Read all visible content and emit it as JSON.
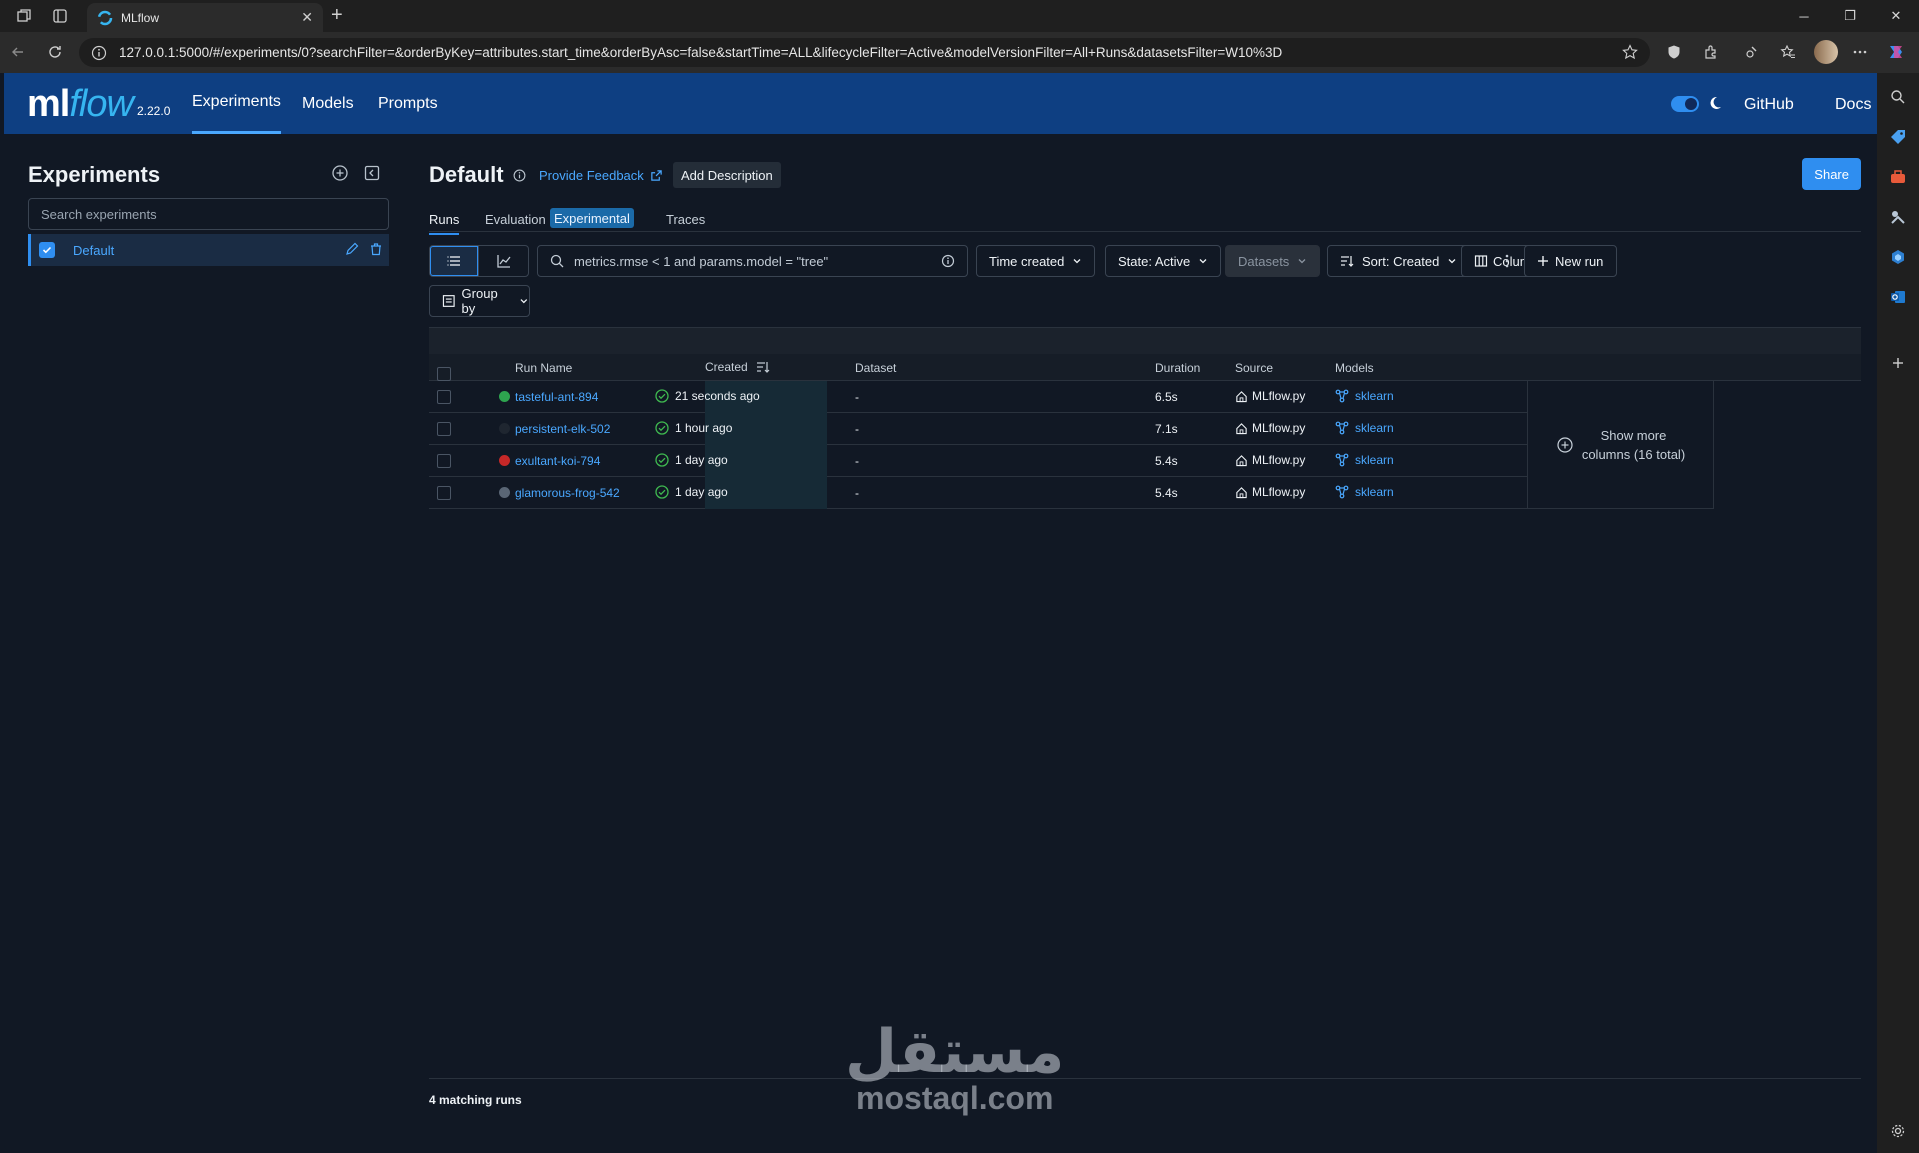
{
  "browser": {
    "tab_title": "MLflow",
    "url": "127.0.0.1:5000/#/experiments/0?searchFilter=&orderByKey=attributes.start_time&orderByAsc=false&startTime=ALL&lifecycleFilter=Active&modelVersionFilter=All+Runs&datasetsFilter=W10%3D"
  },
  "header": {
    "logo_ml": "ml",
    "logo_flow": "flow",
    "version": "2.22.0",
    "nav": [
      "Experiments",
      "Models",
      "Prompts"
    ],
    "links": [
      "GitHub",
      "Docs"
    ]
  },
  "sidebar": {
    "title": "Experiments",
    "search_placeholder": "Search experiments",
    "items": [
      {
        "label": "Default"
      }
    ]
  },
  "main": {
    "title": "Default",
    "feedback": "Provide Feedback",
    "add_description": "Add Description",
    "share": "Share",
    "tabs": {
      "runs": "Runs",
      "evaluation": "Evaluation",
      "experimental": "Experimental",
      "traces": "Traces"
    },
    "filter_text": "metrics.rmse < 1 and params.model = \"tree\"",
    "time_created": "Time created",
    "state": "State: Active",
    "datasets": "Datasets",
    "sort": "Sort: Created",
    "columns": "Columns",
    "new_run": "New run",
    "group_by": "Group by",
    "table": {
      "headers": {
        "run_name": "Run Name",
        "created": "Created",
        "dataset": "Dataset",
        "duration": "Duration",
        "source": "Source",
        "models": "Models"
      },
      "rows": [
        {
          "name": "tasteful-ant-894",
          "color": "#2ea44f",
          "created": "21 seconds ago",
          "dataset": "-",
          "duration": "6.5s",
          "source": "MLflow.py",
          "model": "sklearn"
        },
        {
          "name": "persistent-elk-502",
          "color": "#1f2630",
          "created": "1 hour ago",
          "dataset": "-",
          "duration": "7.1s",
          "source": "MLflow.py",
          "model": "sklearn"
        },
        {
          "name": "exultant-koi-794",
          "color": "#c62828",
          "created": "1 day ago",
          "dataset": "-",
          "duration": "5.4s",
          "source": "MLflow.py",
          "model": "sklearn"
        },
        {
          "name": "glamorous-frog-542",
          "color": "#5a6675",
          "created": "1 day ago",
          "dataset": "-",
          "duration": "5.4s",
          "source": "MLflow.py",
          "model": "sklearn"
        }
      ],
      "show_more_line1": "Show more",
      "show_more_line2": "columns (16 total)"
    },
    "matching_runs": "4 matching runs"
  },
  "watermark": {
    "arabic": "مستقل",
    "latin": "mostaql.com"
  }
}
